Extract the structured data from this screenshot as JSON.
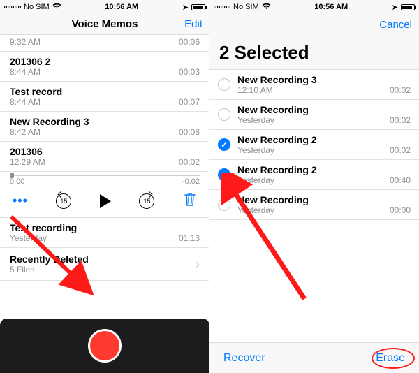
{
  "status": {
    "carrier": "No SIM",
    "time": "10:56 AM",
    "wifi_icon": "wifi-icon"
  },
  "left": {
    "title": "Voice Memos",
    "edit": "Edit",
    "top_time_line": {
      "time": "9:32 AM",
      "dur": "00:06"
    },
    "rows": [
      {
        "title": "201306 2",
        "time": "8:44 AM",
        "dur": "00:03"
      },
      {
        "title": "Test record",
        "time": "8:44 AM",
        "dur": "00:07"
      },
      {
        "title": "New Recording 3",
        "time": "8:42 AM",
        "dur": "00:08"
      },
      {
        "title": "201306",
        "time": "12:29 AM",
        "dur": "00:02"
      }
    ],
    "scrub": {
      "start": "0:00",
      "end": "-0:02"
    },
    "controls": {
      "skip": "15"
    },
    "below": {
      "title": "Test recording",
      "time": "Yesterday",
      "dur": "01:13"
    },
    "recently": {
      "title": "Recently Deleted",
      "sub": "5 Files"
    }
  },
  "right": {
    "cancel": "Cancel",
    "heading": "2 Selected",
    "rows": [
      {
        "title": "New Recording 3",
        "sub": "12:10 AM",
        "dur": "00:02",
        "checked": false
      },
      {
        "title": "New Recording",
        "sub": "Yesterday",
        "dur": "00:02",
        "checked": false
      },
      {
        "title": "New Recording 2",
        "sub": "Yesterday",
        "dur": "00:02",
        "checked": true
      },
      {
        "title": "New Recording 2",
        "sub": "Yesterday",
        "dur": "00:40",
        "checked": true
      },
      {
        "title": "New Recording",
        "sub": "Yesterday",
        "dur": "00:00",
        "checked": false
      }
    ],
    "toolbar": {
      "recover": "Recover",
      "erase": "Erase"
    }
  }
}
